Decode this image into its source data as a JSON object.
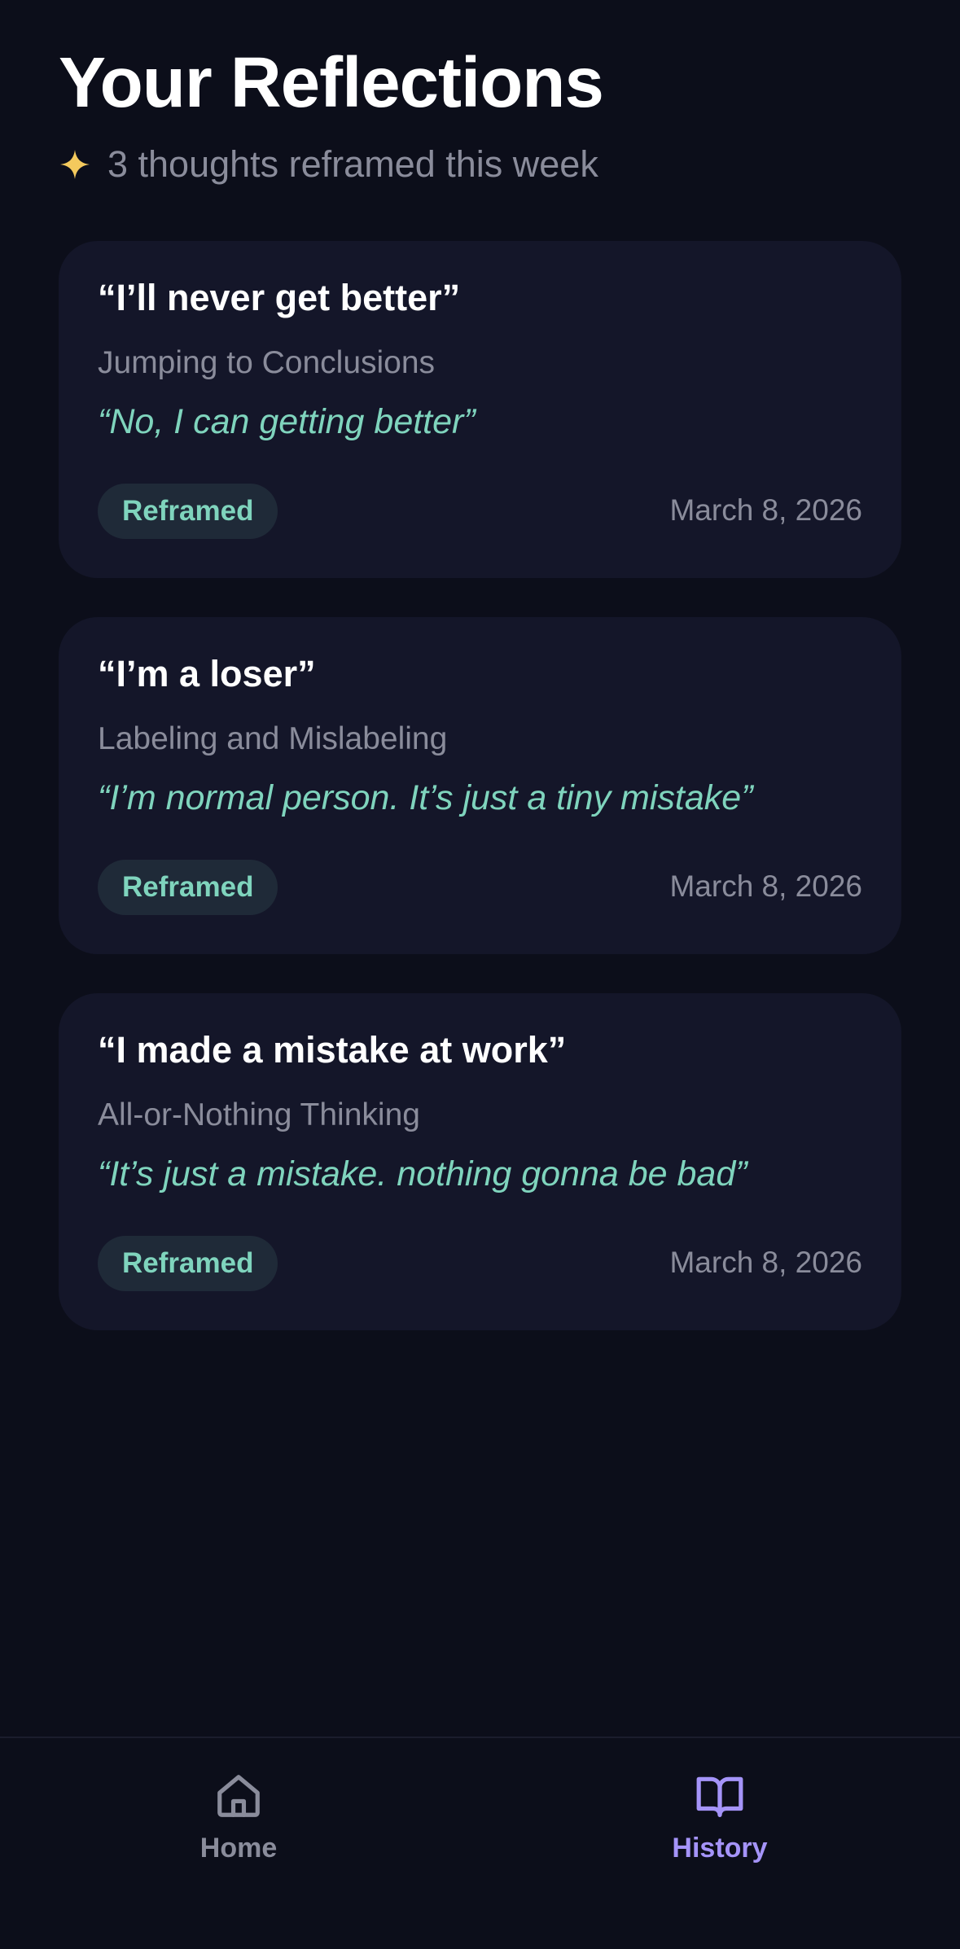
{
  "header": {
    "title": "Your Reflections",
    "subtitle": "3 thoughts reframed this week",
    "subtitle_icon": "sparkle-icon"
  },
  "colors": {
    "background": "#0c0e1a",
    "card": "#141629",
    "accent_green": "#7fd4bd",
    "accent_purple": "#a594f9",
    "sparkle": "#f4c95d",
    "muted_text": "#8a8c9b"
  },
  "reflections": [
    {
      "thought": "“I’ll never get better”",
      "distortion": "Jumping to Conclusions",
      "reframe": "“No, I can getting better”",
      "status": "Reframed",
      "date": "March 8, 2026"
    },
    {
      "thought": "“I’m a loser”",
      "distortion": "Labeling and Mislabeling",
      "reframe": "“I’m normal person. It’s just a tiny mistake”",
      "status": "Reframed",
      "date": "March 8, 2026"
    },
    {
      "thought": "“I made a mistake at work”",
      "distortion": "All-or-Nothing Thinking",
      "reframe": "“It’s just a mistake. nothing gonna be bad”",
      "status": "Reframed",
      "date": "March 8, 2026"
    }
  ],
  "nav": {
    "items": [
      {
        "label": "Home",
        "icon": "home-icon",
        "active": false
      },
      {
        "label": "History",
        "icon": "book-icon",
        "active": true
      }
    ]
  }
}
